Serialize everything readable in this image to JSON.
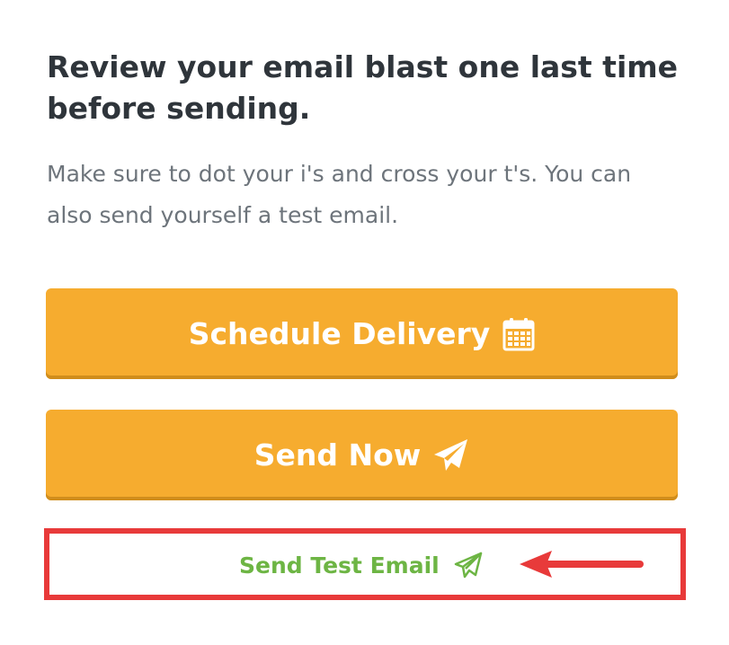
{
  "heading": "Review your email blast one last time before sending.",
  "subtext": "Make sure to dot your i's and cross your t's. You can also send yourself a test email.",
  "buttons": {
    "schedule_label": "Schedule Delivery",
    "schedule_icon": "calendar-icon",
    "send_now_label": "Send Now",
    "send_now_icon": "paper-plane-icon"
  },
  "test_email": {
    "label": "Send Test Email",
    "icon": "paper-plane-outline-icon"
  },
  "colors": {
    "button": "#f6ac2f",
    "test_link": "#6db544",
    "highlight": "#e83a3a"
  }
}
